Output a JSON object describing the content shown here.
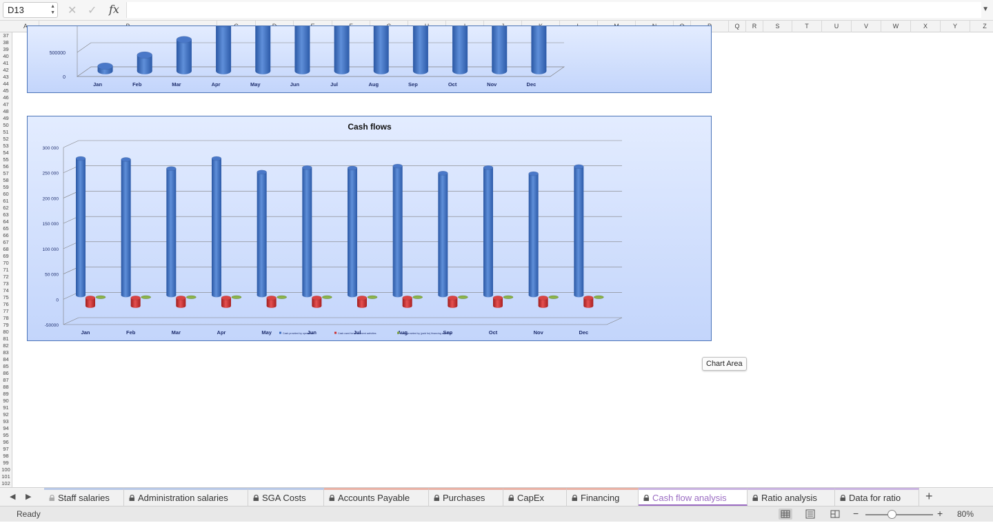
{
  "formula_bar": {
    "name_box": "D13",
    "cancel_icon": "x-icon",
    "enter_icon": "check-icon",
    "fx_label": "fx",
    "formula": ""
  },
  "columns": [
    "A",
    "B",
    "C",
    "D",
    "E",
    "F",
    "G",
    "H",
    "I",
    "J",
    "K",
    "L",
    "M",
    "N",
    "O",
    "P",
    "Q",
    "R",
    "S",
    "T",
    "U",
    "V",
    "W",
    "X",
    "Y",
    "Z"
  ],
  "rows": [
    "37",
    "38",
    "39",
    "40",
    "41",
    "42",
    "43",
    "44",
    "45",
    "46",
    "47",
    "48",
    "49",
    "50",
    "51",
    "52",
    "53",
    "54",
    "55",
    "56",
    "57",
    "58",
    "59",
    "60",
    "61",
    "62",
    "63",
    "64",
    "65",
    "66",
    "67",
    "68",
    "69",
    "70",
    "71",
    "72",
    "73",
    "74",
    "75",
    "76",
    "77",
    "78",
    "79",
    "80",
    "81",
    "82",
    "83",
    "84",
    "85",
    "86",
    "87",
    "88",
    "89",
    "90",
    "91",
    "92",
    "93",
    "94",
    "95",
    "96",
    "97",
    "98",
    "99",
    "100",
    "101",
    "102"
  ],
  "chart_data": [
    {
      "type": "bar",
      "title": "",
      "categories": [
        "Jan",
        "Feb",
        "Mar",
        "Apr",
        "May",
        "Jun",
        "Jul",
        "Aug",
        "Sep",
        "Oct",
        "Nov",
        "Dec"
      ],
      "values": [
        100000,
        330000,
        650000,
        980000,
        1000000,
        1000000,
        1000000,
        1000000,
        1000000,
        1000000,
        1000000,
        1000000
      ],
      "y_tick_labels": [
        "0",
        "500000"
      ],
      "ylim": [
        0,
        1000000
      ],
      "note": "chart partially scrolled out of view; upper portion clipped"
    },
    {
      "type": "bar",
      "title": "Cash flows",
      "categories": [
        "Jan",
        "Feb",
        "Mar",
        "Apr",
        "May",
        "Jun",
        "Jul",
        "Aug",
        "Sep",
        "Oct",
        "Nov",
        "Dec"
      ],
      "series": [
        {
          "name": "Cash provided by operations",
          "color": "#3f6fc0",
          "values": [
            270000,
            268000,
            250000,
            270000,
            243000,
            252000,
            251000,
            255000,
            241000,
            252000,
            240000,
            254000
          ]
        },
        {
          "name": "Cash used for investment activities",
          "color": "#cc2d2d",
          "values": [
            -13000,
            -13000,
            -13000,
            -13000,
            -13000,
            -13000,
            -13000,
            -13000,
            -13000,
            -13000,
            -13000,
            -13000
          ]
        },
        {
          "name": "Cash provided by (paid for) financing activities",
          "color": "#7ea63a",
          "values": [
            -2000,
            -2000,
            -2000,
            -2000,
            -2000,
            -2000,
            -2000,
            -2000,
            -2000,
            -2000,
            -2000,
            -2000
          ]
        }
      ],
      "y_tick_labels": [
        "-50000",
        "0",
        "50 000",
        "100 000",
        "150 000",
        "200 000",
        "250 000",
        "300 000"
      ],
      "y_ticks": [
        -50000,
        0,
        50000,
        100000,
        150000,
        200000,
        250000,
        300000
      ],
      "ylim": [
        -50000,
        300000
      ],
      "legend": "bottom",
      "grid": true
    }
  ],
  "tooltip": "Chart Area",
  "sheet_tabs": [
    {
      "label": "Staff salaries",
      "color": "#b8c8e6",
      "locked": true
    },
    {
      "label": "Administration salaries",
      "color": "#b8c8e6",
      "locked": true
    },
    {
      "label": "SGA Costs",
      "color": "#b8c8e6",
      "locked": true
    },
    {
      "label": "Accounts Payable",
      "color": "#e9b2a6",
      "locked": true
    },
    {
      "label": "Purchases",
      "color": "#e9b2a6",
      "locked": true
    },
    {
      "label": "CapEx",
      "color": "#e9b2a6",
      "locked": true
    },
    {
      "label": "Financing",
      "color": "#e9b2a6",
      "locked": true
    },
    {
      "label": "Cash flow analysis",
      "color": "#c9b3e0",
      "locked": true,
      "active": true
    },
    {
      "label": "Ratio analysis",
      "color": "#c9b3e0",
      "locked": true
    },
    {
      "label": "Data for ratio",
      "color": "#c9b3e0",
      "locked": true
    }
  ],
  "add_sheet_label": "+",
  "status": {
    "text": "Ready",
    "zoom": "80%",
    "zoom_minus": "−",
    "zoom_plus": "+"
  }
}
